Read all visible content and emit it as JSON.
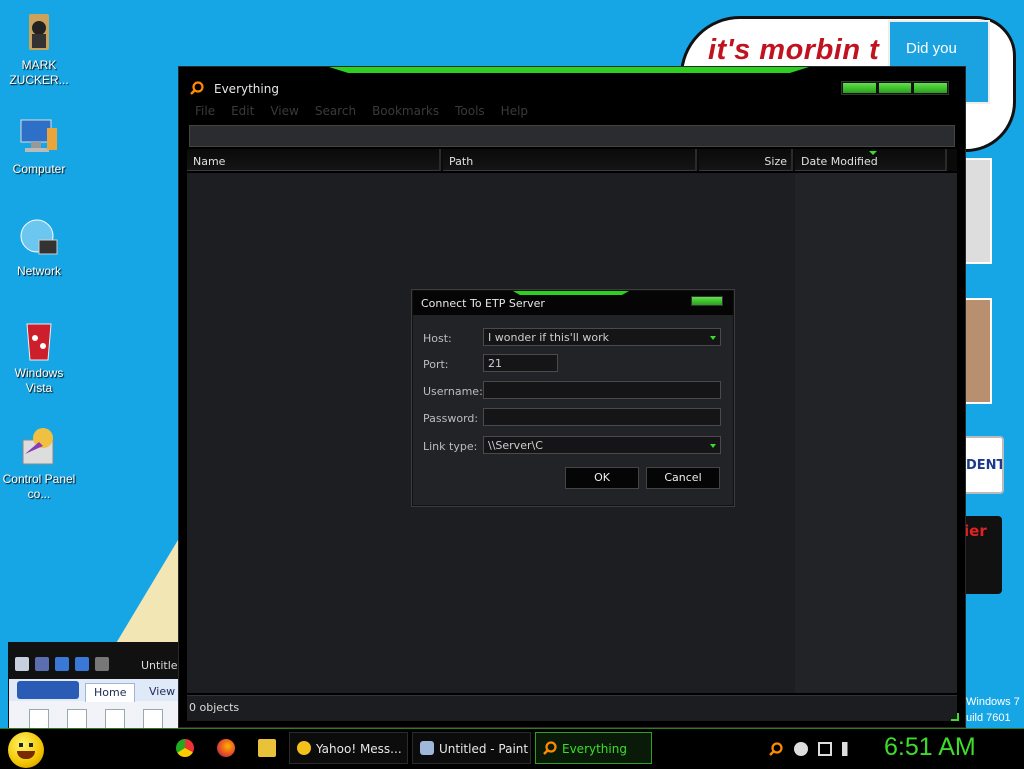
{
  "desktop": {
    "background_text": {
      "morbin": "it's morbin t",
      "did_you": "Did you",
      "student": "DENT",
      "red_sign": "ier",
      "win_line1": "Windows 7",
      "win_line2": "uild 7601"
    },
    "icons": [
      {
        "label": "MARK ZUCKER..."
      },
      {
        "label": "Computer"
      },
      {
        "label": "Network"
      },
      {
        "label": "Windows Vista"
      },
      {
        "label": "Control Panel co..."
      }
    ]
  },
  "everything_window": {
    "title": "Everything",
    "menu": [
      "File",
      "Edit",
      "View",
      "Search",
      "Bookmarks",
      "Tools",
      "Help"
    ],
    "columns": {
      "name": "Name",
      "path": "Path",
      "size": "Size",
      "date_modified": "Date Modified"
    },
    "status": "0 objects"
  },
  "dialog": {
    "title": "Connect To ETP Server",
    "host_label": "Host:",
    "host_value": "I wonder if this'll work",
    "port_label": "Port:",
    "port_value": "21",
    "username_label": "Username:",
    "username_value": "",
    "password_label": "Password:",
    "password_value": "",
    "link_type_label": "Link type:",
    "link_type_value": "\\\\Server\\C",
    "ok_label": "OK",
    "cancel_label": "Cancel"
  },
  "paint": {
    "title": "Untitled",
    "tabs": [
      "Home",
      "View"
    ]
  },
  "taskbar": {
    "tasks": [
      {
        "label": "Yahoo! Mess..."
      },
      {
        "label": "Untitled - Paint"
      },
      {
        "label": "Everything"
      }
    ],
    "clock": "6:51 AM"
  },
  "colors": {
    "accent_green": "#3ddc2b",
    "desktop_blue": "#16a6e6",
    "window_bg": "#1d1e21"
  }
}
